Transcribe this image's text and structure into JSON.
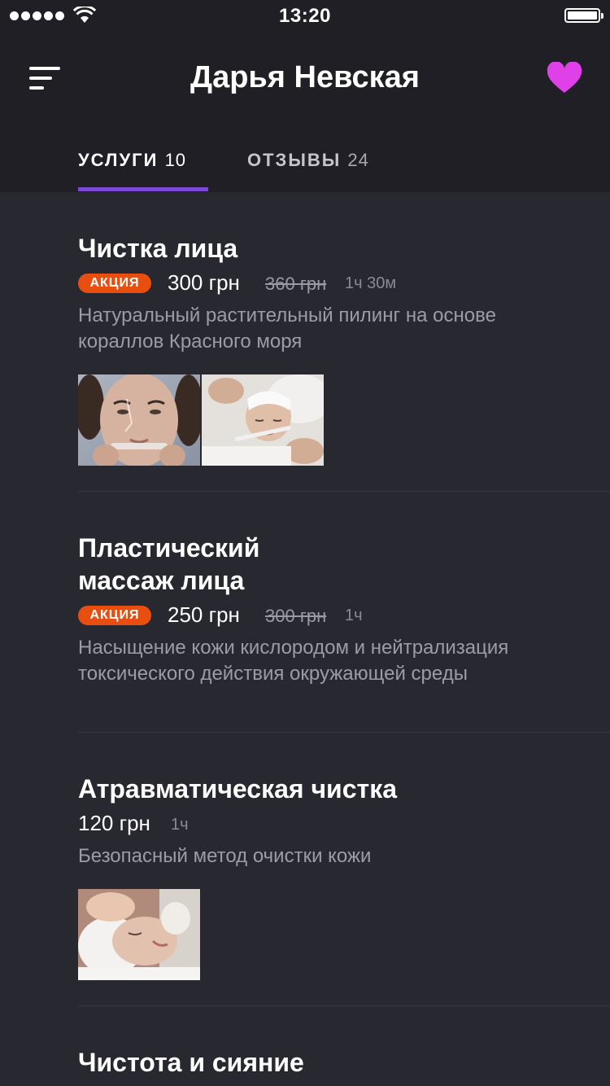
{
  "status_bar": {
    "time": "13:20"
  },
  "header": {
    "title": "Дарья Невская",
    "menu_icon": "menu-lines-icon",
    "favorite_icon": "heart-icon",
    "favorite_color": "#e040e8"
  },
  "tabs": [
    {
      "label": "УСЛУГИ",
      "count": "10",
      "active": true
    },
    {
      "label": "ОТЗЫВЫ",
      "count": "24",
      "active": false
    }
  ],
  "accent_color": "#7a4ad6",
  "badge_color": "#e84e10",
  "services": [
    {
      "title": "Чистка лица",
      "badge": "АКЦИЯ",
      "price": "300 грн",
      "old_price": "360 грн",
      "duration": "1ч 30м",
      "description": "Натуральный растительный пилинг на основе кораллов Красного моря",
      "photos": [
        "face-cleansing-photo-1",
        "face-cleansing-photo-2"
      ]
    },
    {
      "title_line1": "Пластический",
      "title_line2": "массаж лица",
      "badge": "АКЦИЯ",
      "price": "250 грн",
      "old_price": "300 грн",
      "duration": "1ч",
      "description": "Насыщение кожи кислородом и нейтрализация токсического действия окружающей среды"
    },
    {
      "title": "Атравматическая чистка",
      "price": "120 грн",
      "duration": "1ч",
      "description": "Безопасный метод очистки кожи",
      "photos": [
        "atraumatic-cleansing-photo"
      ]
    },
    {
      "title": "Чистота и сияние"
    }
  ]
}
